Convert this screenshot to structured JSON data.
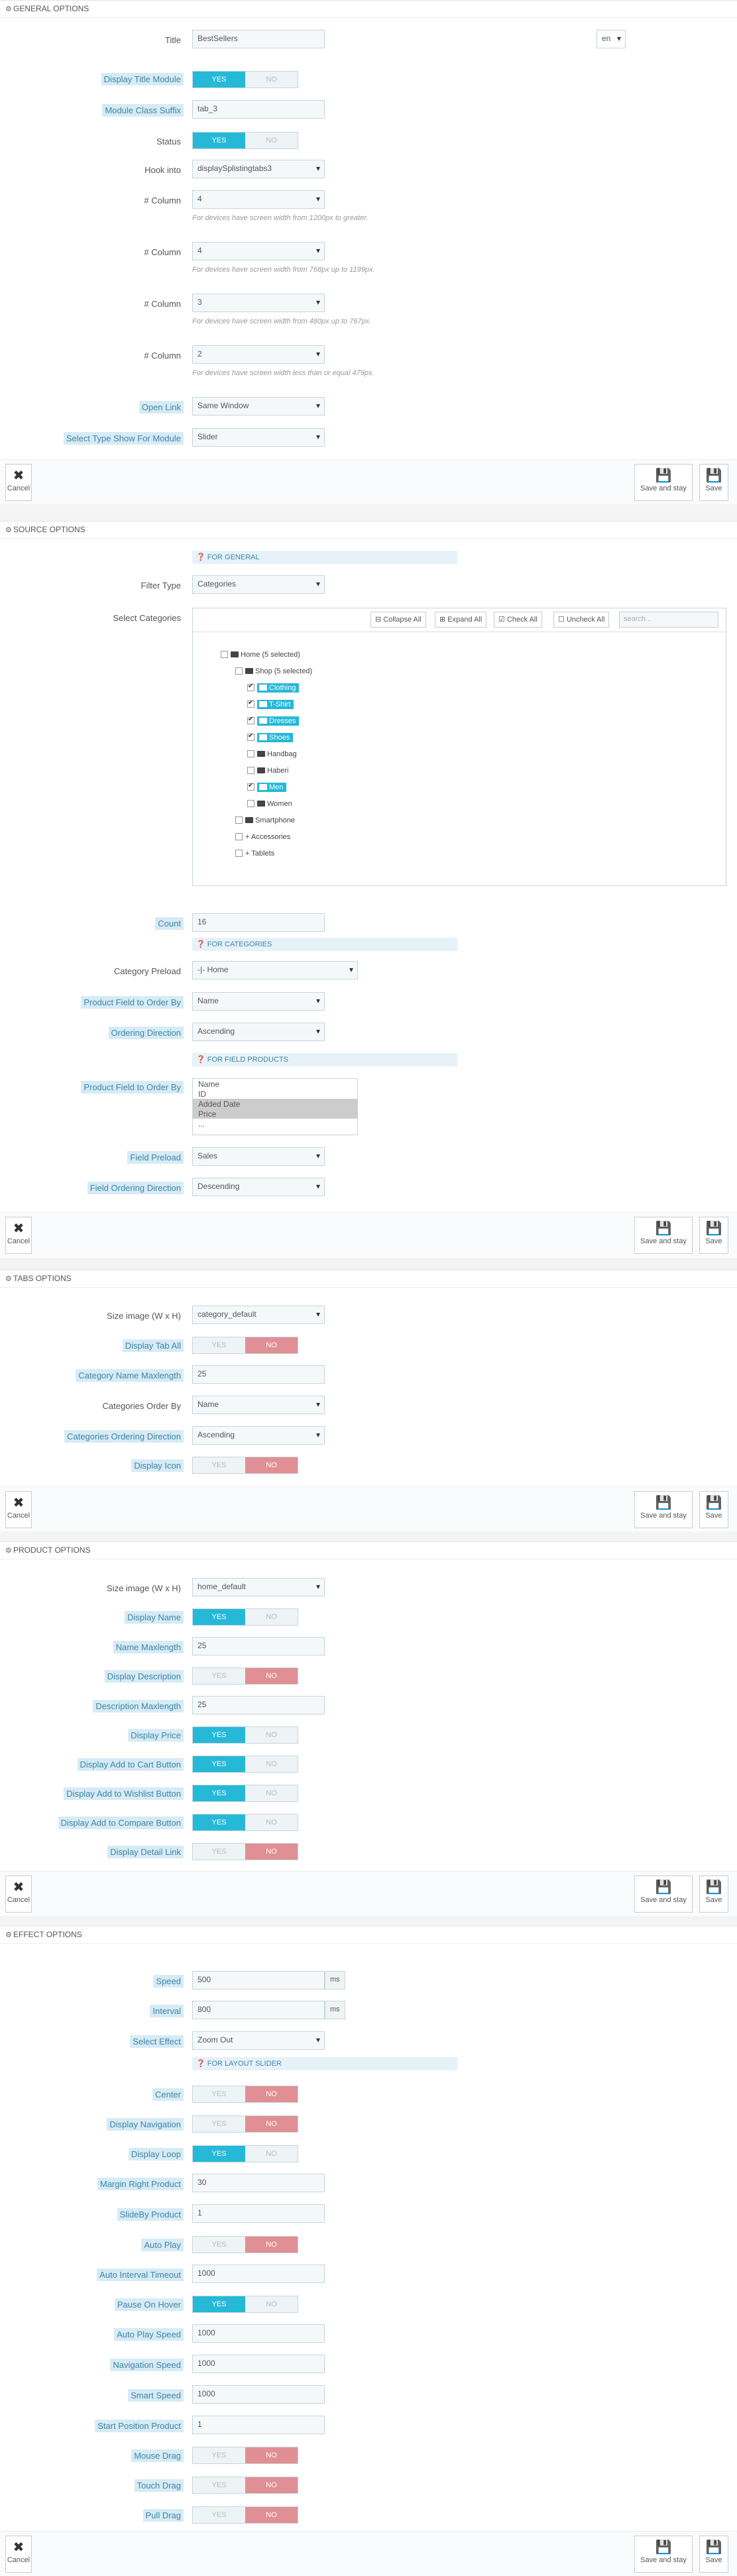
{
  "general": {
    "header": "GENERAL OPTIONS",
    "title_label": "Title",
    "title_value": "BestSellers",
    "lang": "en",
    "display_title_label": "Display Title Module",
    "module_class_label": "Module Class Suffix",
    "module_class_value": "tab_3",
    "status_label": "Status",
    "hook_label": "Hook into",
    "hook_value": "displaySplistingtabs3",
    "col1_label": "# Column",
    "col1_value": "4",
    "col1_help": "For devices have screen width from 1200px to greater.",
    "col2_label": "# Column",
    "col2_value": "4",
    "col2_help": "For devices have screen width from 768px up to 1199px.",
    "col3_label": "# Column",
    "col3_value": "3",
    "col3_help": "For devices have screen width from 480px up to 767px.",
    "col4_label": "# Column",
    "col4_value": "2",
    "col4_help": "For devices have screen width less than or equal 479px.",
    "open_link_label": "Open Link",
    "open_link_value": "Same Window",
    "type_show_label": "Select Type Show For Module",
    "type_show_value": "Slider"
  },
  "toggle": {
    "yes": "YES",
    "no": "NO"
  },
  "buttons": {
    "cancel": "Cancel",
    "save_stay": "Save and stay",
    "save": "Save"
  },
  "source": {
    "header": "SOURCE OPTIONS",
    "for_general": "FOR GENERAL",
    "filter_type_label": "Filter Type",
    "filter_type_value": "Categories",
    "select_categories_label": "Select Categories",
    "collapse_all": "Collapse All",
    "expand_all": "Expand All",
    "check_all": "Check All",
    "uncheck_all": "Uncheck All",
    "search_placeholder": "search...",
    "tree": {
      "home": "Home (5 selected)",
      "shop": "Shop (5 selected)",
      "clothing": "Clothing",
      "tshirt": "T-Shirt",
      "dresses": "Dresses",
      "shoes": "Shoes",
      "handbag": "Handbag",
      "haberi": "Haberi",
      "men": "Men",
      "women": "Women",
      "smartphone": "Smartphone",
      "accessories": "Accessories",
      "tablets": "Tablets"
    },
    "count_label": "Count",
    "count_value": "16",
    "for_categories": "FOR CATEGORIES",
    "category_preload_label": "Category Preload",
    "category_preload_value": "-|- Home",
    "product_field_label": "Product Field to Order By",
    "product_field_value": "Name",
    "ordering_direction_label": "Ordering Direction",
    "ordering_direction_value": "Ascending",
    "for_field_products": "FOR FIELD PRODUCTS",
    "product_field2_label": "Product Field to Order By",
    "product_field2_options": [
      "Name",
      "ID",
      "Added Date",
      "Price",
      "..."
    ],
    "field_preload_label": "Field Preload",
    "field_preload_value": "Sales",
    "field_ordering_label": "Field Ordering Direction",
    "field_ordering_value": "Descending"
  },
  "tabs": {
    "header": "TABS OPTIONS",
    "size_image_label": "Size image (W x H)",
    "size_image_value": "category_default",
    "display_tab_all_label": "Display Tab All",
    "cat_name_max_label": "Category Name Maxlength",
    "cat_name_max_value": "25",
    "cat_order_label": "Categories Order By",
    "cat_order_value": "Name",
    "cat_dir_label": "Categories Ordering Direction",
    "cat_dir_value": "Ascending",
    "display_icon_label": "Display Icon"
  },
  "product": {
    "header": "PRODUCT OPTIONS",
    "size_image_label": "Size image (W x H)",
    "size_image_value": "home_default",
    "display_name_label": "Display Name",
    "name_max_label": "Name Maxlength",
    "name_max_value": "25",
    "display_desc_label": "Display Description",
    "desc_max_label": "Description Maxlength",
    "desc_max_value": "25",
    "display_price_label": "Display Price",
    "add_cart_label": "Display Add to Cart Button",
    "add_wishlist_label": "Display Add to Wishlist Button",
    "add_compare_label": "Display Add to Compare Button",
    "detail_link_label": "Display Detail Link"
  },
  "effect": {
    "header": "EFFECT OPTIONS",
    "speed_label": "Speed",
    "speed_value": "500",
    "ms": "ms",
    "interval_label": "Interval",
    "interval_value": "800",
    "select_effect_label": "Select Effect",
    "select_effect_value": "Zoom Out",
    "for_layout_slider": "FOR LAYOUT SLIDER",
    "center_label": "Center",
    "display_nav_label": "Display Navigation",
    "display_loop_label": "Display Loop",
    "margin_right_label": "Margin Right Product",
    "margin_right_value": "30",
    "slideby_label": "SlideBy Product",
    "slideby_value": "1",
    "auto_play_label": "Auto Play",
    "auto_interval_label": "Auto Interval Timeout",
    "auto_interval_value": "1000",
    "pause_hover_label": "Pause On Hover",
    "auto_play_speed_label": "Auto Play Speed",
    "auto_play_speed_value": "1000",
    "nav_speed_label": "Navigation Speed",
    "nav_speed_value": "1000",
    "smart_speed_label": "Smart Speed",
    "smart_speed_value": "1000",
    "start_pos_label": "Start Position Product",
    "start_pos_value": "1",
    "mouse_drag_label": "Mouse Drag",
    "touch_drag_label": "Touch Drag",
    "pull_drag_label": "Pull Drag"
  }
}
